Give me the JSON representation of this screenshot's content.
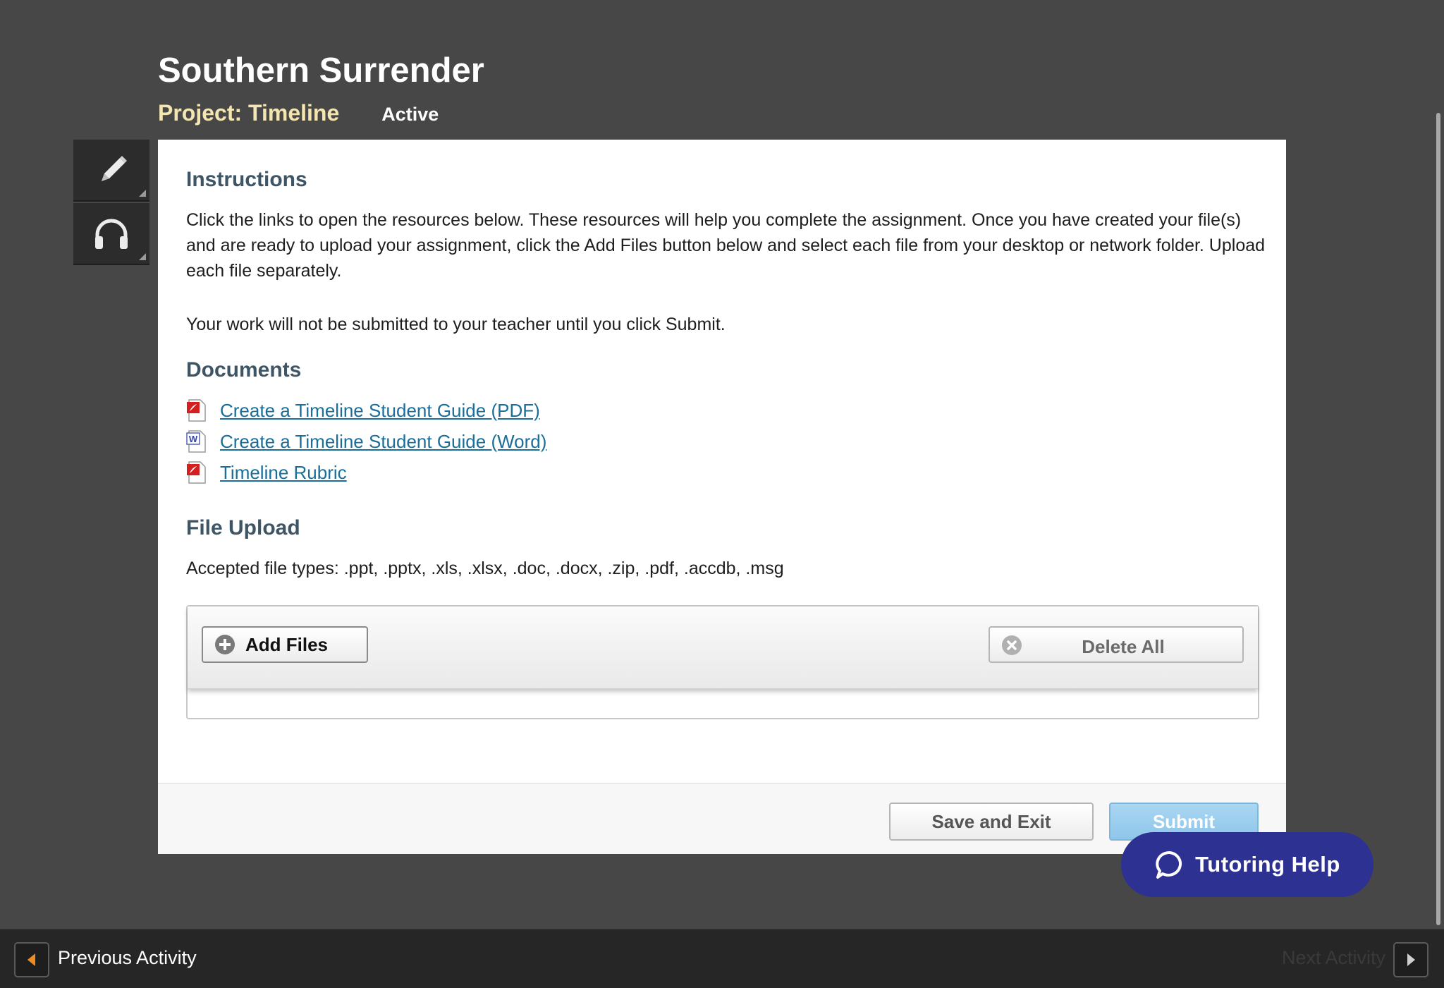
{
  "header": {
    "title": "Southern Surrender",
    "project": "Project: Timeline",
    "status": "Active"
  },
  "tools": [
    {
      "icon": "pencil-icon"
    },
    {
      "icon": "headphones-icon"
    }
  ],
  "instructions": {
    "heading": "Instructions",
    "paragraph1": "Click the links to open the resources below. These resources will help you complete the assignment. Once you have created your file(s) and are ready to upload your assignment, click the Add Files button below and select each file from your desktop or network folder. Upload each file separately.",
    "paragraph2": "Your work will not be submitted to your teacher until you click Submit."
  },
  "documents": {
    "heading": "Documents",
    "items": [
      {
        "label": "Create a Timeline Student Guide (PDF)",
        "icon": "pdf-file-icon"
      },
      {
        "label": "Create a Timeline Student Guide (Word)",
        "icon": "word-file-icon"
      },
      {
        "label": "Timeline Rubric",
        "icon": "pdf-file-icon"
      }
    ]
  },
  "file_upload": {
    "heading": "File Upload",
    "accepted": "Accepted file types: .ppt, .pptx, .xls, .xlsx, .doc, .docx, .zip, .pdf, .accdb, .msg",
    "add_label": "Add Files",
    "delete_label": "Delete All"
  },
  "footer": {
    "save_label": "Save and Exit",
    "submit_label": "Submit"
  },
  "tutoring": {
    "label": "Tutoring Help"
  },
  "nav": {
    "previous": "Previous Activity",
    "next": "Next Activity"
  },
  "colors": {
    "background": "#474747",
    "project_label": "#f4e6b0",
    "heading": "#3e5565",
    "link": "#1a6e99",
    "tutoring": "#2c3192",
    "submit": "#8fc6ea",
    "prev_arrow": "#f08a24"
  }
}
